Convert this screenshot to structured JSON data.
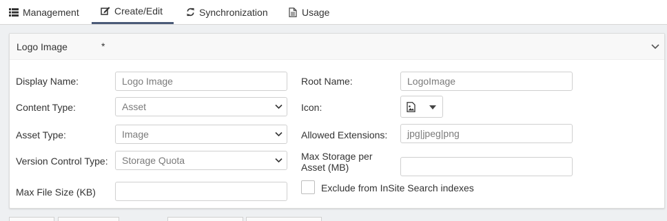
{
  "tabs": [
    {
      "label": "Management",
      "icon": "list-icon"
    },
    {
      "label": "Create/Edit",
      "icon": "edit-icon",
      "active": true
    },
    {
      "label": "Synchronization",
      "icon": "sync-icon"
    },
    {
      "label": "Usage",
      "icon": "document-icon"
    }
  ],
  "panel": {
    "title": "Logo Image",
    "required_marker": "*"
  },
  "form": {
    "display_name": {
      "label": "Display Name:",
      "value": "Logo Image"
    },
    "content_type": {
      "label": "Content Type:",
      "value": "Asset"
    },
    "asset_type": {
      "label": "Asset Type:",
      "value": "Image"
    },
    "version_control_type": {
      "label": "Version Control Type:",
      "value": "Storage Quota"
    },
    "max_file_size": {
      "label": "Max File Size (KB)",
      "value": ""
    },
    "root_name": {
      "label": "Root Name:",
      "value": "LogoImage"
    },
    "icon": {
      "label": "Icon:",
      "value_icon": "image-file-icon"
    },
    "allowed_extensions": {
      "label": "Allowed Extensions:",
      "value": "jpg|jpeg|png"
    },
    "max_storage": {
      "label_line1": "Max Storage per",
      "label_line2": "Asset (MB)",
      "value": ""
    },
    "exclude_search": {
      "label": "Exclude from InSite Search indexes",
      "checked": false
    }
  },
  "colors": {
    "active_tab_underline": "#4a5a78",
    "page_background": "#eef0f2",
    "panel_header": "#f8f8f8"
  }
}
